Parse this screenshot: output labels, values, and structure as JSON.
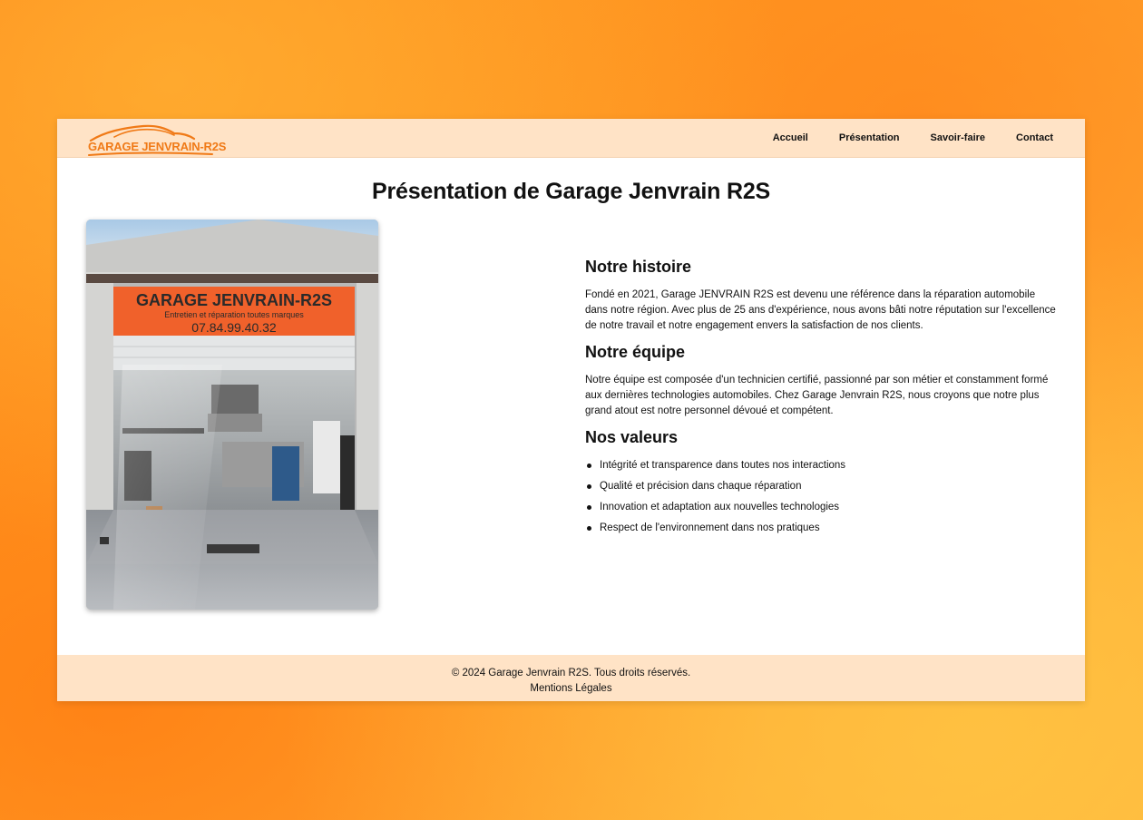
{
  "brand": {
    "logo_text": "GARAGE JENVRAIN-R2S",
    "accent_color": "#f07a17",
    "nav_bg": "#ffe3c6"
  },
  "nav": {
    "items": [
      {
        "label": "Accueil"
      },
      {
        "label": "Présentation"
      },
      {
        "label": "Savoir-faire"
      },
      {
        "label": "Contact"
      }
    ]
  },
  "main": {
    "title": "Présentation de Garage Jenvrain R2S",
    "photo": {
      "sign_title": "GARAGE JENVRAIN-R2S",
      "sign_subtitle": "Entretien et réparation toutes marques",
      "sign_phone": "07.84.99.40.32"
    },
    "sections": [
      {
        "heading": "Notre histoire",
        "text": "Fondé en 2021, Garage JENVRAIN R2S est devenu une référence dans la réparation automobile dans notre région. Avec plus de 25 ans d'expérience, nous avons bâti notre réputation sur l'excellence de notre travail et notre engagement envers la satisfaction de nos clients."
      },
      {
        "heading": "Notre équipe",
        "text": "Notre équipe est composée d'un technicien certifié, passionné par son métier et constamment formé aux dernières technologies automobiles. Chez Garage Jenvrain R2S, nous croyons que notre plus grand atout est notre personnel dévoué et compétent."
      },
      {
        "heading": "Nos valeurs",
        "items": [
          "Intégrité et transparence dans toutes nos interactions",
          "Qualité et précision dans chaque réparation",
          "Innovation et adaptation aux nouvelles technologies",
          "Respect de l'environnement dans nos pratiques"
        ]
      }
    ]
  },
  "footer": {
    "copyright": "© 2024 Garage Jenvrain R2S. Tous droits réservés.",
    "legal_link": "Mentions Légales"
  }
}
